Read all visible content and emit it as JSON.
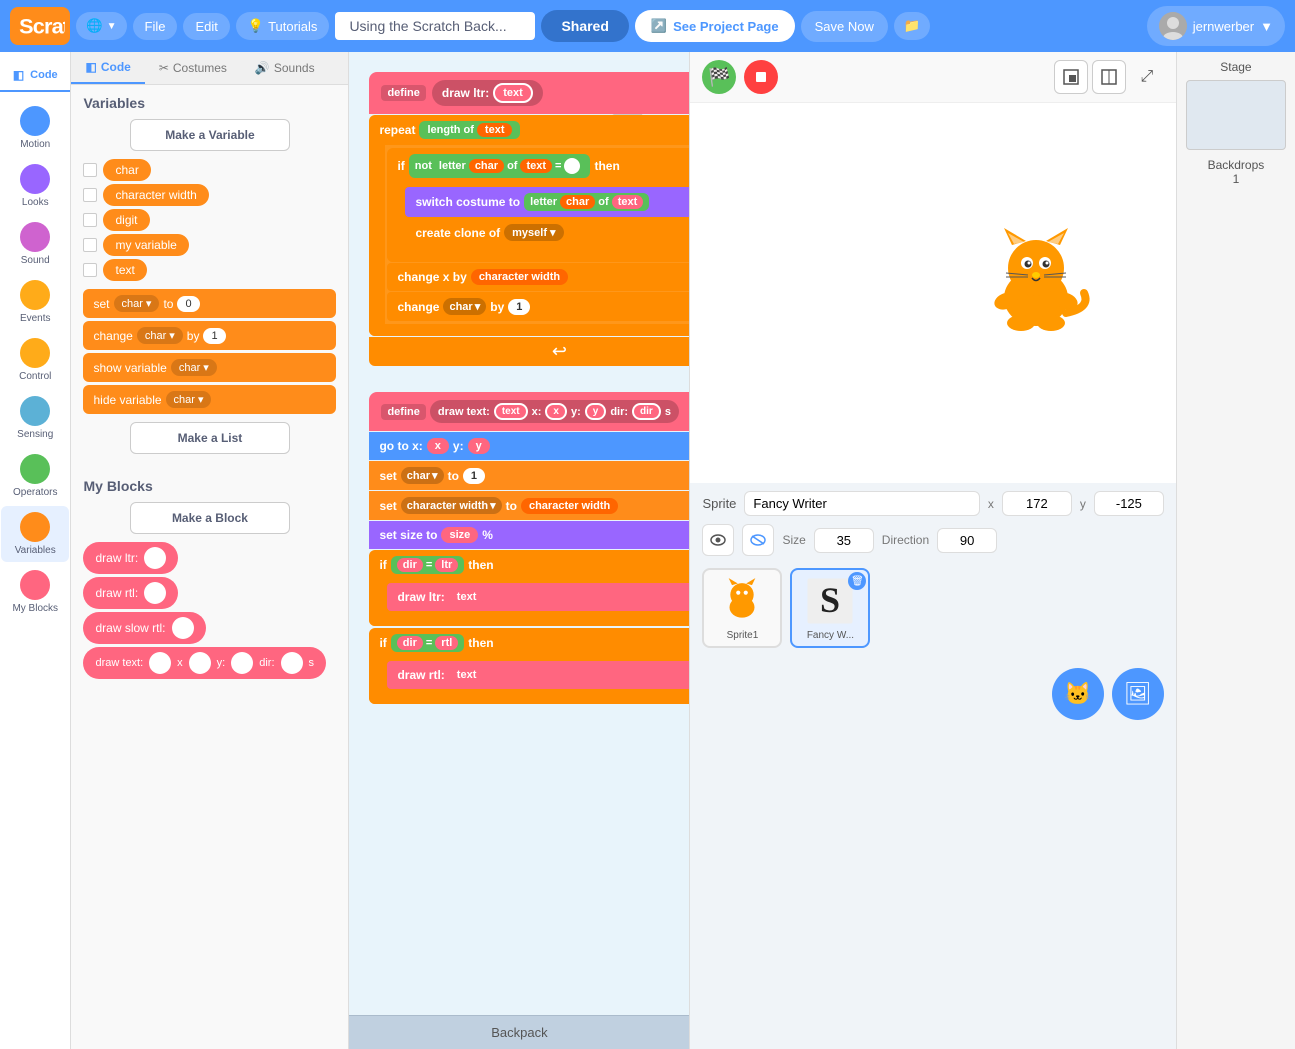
{
  "topnav": {
    "logo": "Scratch",
    "globe_label": "🌐",
    "file_label": "File",
    "edit_label": "Edit",
    "tutorials_label": "Tutorials",
    "project_name": "Using the Scratch Back...",
    "shared_label": "Shared",
    "see_project_label": "See Project Page",
    "save_label": "Save Now",
    "user_label": "jernwerber"
  },
  "tabs": {
    "code": "Code",
    "costumes": "Costumes",
    "sounds": "Sounds"
  },
  "categories": [
    {
      "id": "motion",
      "label": "Motion",
      "color": "#4d97ff"
    },
    {
      "id": "looks",
      "label": "Looks",
      "color": "#9966ff"
    },
    {
      "id": "sound",
      "label": "Sound",
      "color": "#cf63cf"
    },
    {
      "id": "events",
      "label": "Events",
      "color": "#ffab19"
    },
    {
      "id": "control",
      "label": "Control",
      "color": "#ffab19"
    },
    {
      "id": "sensing",
      "label": "Sensing",
      "color": "#5cb1d6"
    },
    {
      "id": "operators",
      "label": "Operators",
      "color": "#59c059"
    },
    {
      "id": "variables",
      "label": "Variables",
      "color": "#ff8c1a"
    },
    {
      "id": "myblocks",
      "label": "My Blocks",
      "color": "#ff6680"
    }
  ],
  "variables_section": {
    "title": "Variables",
    "make_variable_btn": "Make a Variable",
    "vars": [
      {
        "name": "char"
      },
      {
        "name": "character width"
      },
      {
        "name": "digit"
      },
      {
        "name": "my variable"
      },
      {
        "name": "text"
      }
    ],
    "set_block1": {
      "prefix": "set",
      "var": "char",
      "to": "to",
      "val": "0"
    },
    "change_block1": {
      "prefix": "change",
      "var": "char",
      "by": "by",
      "val": "1"
    },
    "show_block": {
      "prefix": "show variable",
      "var": "char"
    },
    "hide_block": {
      "prefix": "hide variable",
      "var": "char"
    },
    "make_list_btn": "Make a List"
  },
  "my_blocks_section": {
    "title": "My Blocks",
    "make_block_btn": "Make a Block",
    "blocks": [
      {
        "name": "draw ltr:"
      },
      {
        "name": "draw rtl:"
      },
      {
        "name": "draw slow rtl:"
      },
      {
        "name": "draw text:",
        "args": "x  y:  dir:  s"
      }
    ]
  },
  "code_blocks": {
    "stack1": {
      "define_text": "define  draw ltr:  text",
      "repeat_text": "repeat  length of  text",
      "if_text": "if  not  letter  char  of  text  =",
      "switch_text": "switch costume to  letter  char  of  text",
      "create_text": "create clone of  myself",
      "changex_text": "change x by  character width",
      "change_text": "change  char  by  1",
      "s_char": "S"
    },
    "stack2": {
      "define_text": "define  draw text:  text  x:  x  y:  y  dir:  dir  s",
      "goto_text": "go to x:  x  y:  y",
      "set1_text": "set  char  to  1",
      "set2_text": "set  character width  to  character width",
      "setsize_text": "set size to  size  %",
      "if1_text": "if  dir  =  ltr  then",
      "draw_ltr": "draw ltr:  text",
      "if2_text": "if  dir  =  rtl  then",
      "draw_rtl": "draw rtl:  text"
    }
  },
  "stage": {
    "sprite_label": "Sprite",
    "sprite_name": "Fancy Writer",
    "x_label": "x",
    "x_val": "172",
    "y_label": "y",
    "y_val": "-125",
    "size_label": "Size",
    "size_val": "35",
    "direction_label": "Direction",
    "direction_val": "90",
    "sprites": [
      {
        "name": "Sprite1",
        "selected": false
      },
      {
        "name": "Fancy W...",
        "selected": true
      }
    ],
    "stage_label": "Stage",
    "backdrops_label": "Backdrops",
    "backdrops_count": "1"
  },
  "backpack": {
    "label": "Backpack"
  },
  "zoom_controls": {
    "zoom_in": "+",
    "zoom_out": "-",
    "fit": "="
  }
}
